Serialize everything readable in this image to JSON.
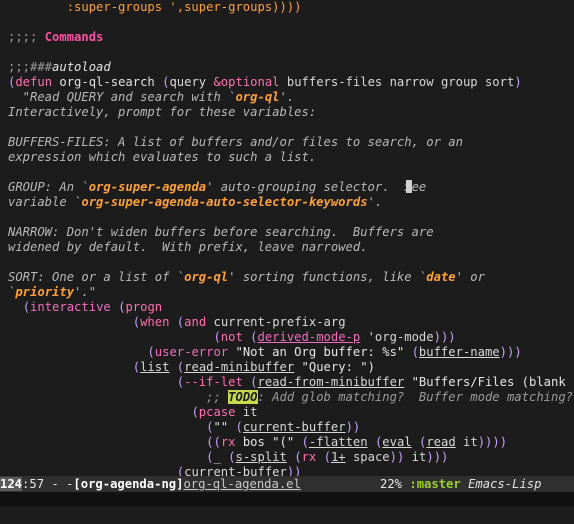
{
  "colors": {
    "background": "#1c1c1c",
    "default": "#d8d8d8",
    "comment": "#9a9a9a",
    "heading": "#ff4fa3",
    "keyword": "#ff6fb0",
    "function_name": "#e0e0e0",
    "docstring": "#b8b8b8",
    "constant": "#ff9f3a",
    "builtin": "#f06fbf",
    "string": "#e6e6e6",
    "paren": "#c7a0ff",
    "todo": "#c7d94a",
    "modeline_bg": "#303030",
    "branch": "#9acd32"
  },
  "editor": {
    "lines": [
      {
        "segments": [
          {
            "t": "        :super-groups ',super-groups))))",
            "c": "#ff9f3a"
          }
        ]
      },
      {
        "segments": []
      },
      {
        "segments": [
          {
            "t": ";;;; ",
            "c": "#9a9a9a"
          },
          {
            "t": "Commands",
            "c": "#ff4fa3",
            "b": true
          }
        ]
      },
      {
        "segments": []
      },
      {
        "segments": [
          {
            "t": ";;;###",
            "c": "#9a9a9a"
          },
          {
            "t": "autoload",
            "c": "#e0e0e0",
            "i": true
          }
        ]
      },
      {
        "segments": [
          {
            "t": "(",
            "c": "#c7a0ff"
          },
          {
            "t": "defun",
            "c": "#ff6fb0"
          },
          {
            "t": " org-ql-search ",
            "c": "#e0e0e0"
          },
          {
            "t": "(",
            "c": "#c7a0ff"
          },
          {
            "t": "query ",
            "c": "#d8d8d8"
          },
          {
            "t": "&optional",
            "c": "#ff6fb0"
          },
          {
            "t": " buffers-files narrow group sort",
            "c": "#d8d8d8"
          },
          {
            "t": ")",
            "c": "#c7a0ff"
          }
        ]
      },
      {
        "segments": [
          {
            "t": "  \"Read QUERY and search with `",
            "c": "#b8b8b8",
            "i": true
          },
          {
            "t": "org-ql",
            "c": "#ff9f3a",
            "b": true,
            "i": true
          },
          {
            "t": "'.",
            "c": "#b8b8b8",
            "i": true
          }
        ]
      },
      {
        "segments": [
          {
            "t": "Interactively, prompt for these variables:",
            "c": "#b8b8b8",
            "i": true
          }
        ]
      },
      {
        "segments": []
      },
      {
        "segments": [
          {
            "t": "BUFFERS-FILES: A list of buffers and/or files to search, or an",
            "c": "#b8b8b8",
            "i": true
          }
        ]
      },
      {
        "segments": [
          {
            "t": "expression which evaluates to such a list.",
            "c": "#b8b8b8",
            "i": true
          }
        ]
      },
      {
        "segments": []
      },
      {
        "segments": [
          {
            "t": "GROUP: An `",
            "c": "#b8b8b8",
            "i": true
          },
          {
            "t": "org-super-agenda",
            "c": "#ff9f3a",
            "b": true,
            "i": true
          },
          {
            "t": "' auto-grouping selector.  See",
            "c": "#b8b8b8",
            "i": true
          }
        ]
      },
      {
        "segments": [
          {
            "t": "variable `",
            "c": "#b8b8b8",
            "i": true
          },
          {
            "t": "org-super-agenda-auto-selector-keywords",
            "c": "#ff9f3a",
            "b": true,
            "i": true
          },
          {
            "t": "'.",
            "c": "#b8b8b8",
            "i": true
          }
        ]
      },
      {
        "segments": []
      },
      {
        "segments": [
          {
            "t": "NARROW: Don't widen buffers before searching.  Buffers are",
            "c": "#b8b8b8",
            "i": true
          }
        ]
      },
      {
        "segments": [
          {
            "t": "widened by default.  With prefix, leave narrowed.",
            "c": "#b8b8b8",
            "i": true
          }
        ]
      },
      {
        "segments": []
      },
      {
        "segments": [
          {
            "t": "SORT: One or a list of `",
            "c": "#b8b8b8",
            "i": true
          },
          {
            "t": "org-ql",
            "c": "#ff9f3a",
            "b": true,
            "i": true
          },
          {
            "t": "' sorting functions, like `",
            "c": "#b8b8b8",
            "i": true
          },
          {
            "t": "date",
            "c": "#ff9f3a",
            "b": true,
            "i": true
          },
          {
            "t": "' or",
            "c": "#b8b8b8",
            "i": true
          }
        ]
      },
      {
        "segments": [
          {
            "t": "`",
            "c": "#b8b8b8",
            "i": true
          },
          {
            "t": "priority",
            "c": "#ff9f3a",
            "b": true,
            "i": true
          },
          {
            "t": "'.\"",
            "c": "#b8b8b8",
            "i": true
          }
        ]
      },
      {
        "segments": [
          {
            "t": "  ",
            "c": "#d8d8d8"
          },
          {
            "t": "(",
            "c": "#c7a0ff"
          },
          {
            "t": "interactive",
            "c": "#f06fbf"
          },
          {
            "t": " ",
            "c": "#d8d8d8"
          },
          {
            "t": "(",
            "c": "#c7a0ff"
          },
          {
            "t": "progn",
            "c": "#ff6fb0"
          }
        ]
      },
      {
        "segments": [
          {
            "t": "                 ",
            "c": "#d8d8d8"
          },
          {
            "t": "(",
            "c": "#c7a0ff"
          },
          {
            "t": "when",
            "c": "#ff6fb0"
          },
          {
            "t": " ",
            "c": "#d8d8d8"
          },
          {
            "t": "(",
            "c": "#c7a0ff"
          },
          {
            "t": "and",
            "c": "#ff6fb0"
          },
          {
            "t": " current-prefix-arg",
            "c": "#d8d8d8"
          }
        ]
      },
      {
        "segments": [
          {
            "t": "                            ",
            "c": "#d8d8d8"
          },
          {
            "t": "(",
            "c": "#c7a0ff"
          },
          {
            "t": "not",
            "c": "#ff6fb0"
          },
          {
            "t": " ",
            "c": "#d8d8d8"
          },
          {
            "t": "(",
            "c": "#c7a0ff"
          },
          {
            "t": "derived-mode-p",
            "c": "#f06fbf",
            "u": true
          },
          {
            "t": " 'org-mode",
            "c": "#d8d8d8"
          },
          {
            "t": ")))",
            "c": "#c7a0ff"
          }
        ]
      },
      {
        "segments": [
          {
            "t": "                   ",
            "c": "#d8d8d8"
          },
          {
            "t": "(",
            "c": "#c7a0ff"
          },
          {
            "t": "user-error",
            "c": "#f06fbf"
          },
          {
            "t": " \"Not an Org buffer: %s\" ",
            "c": "#e6e6e6"
          },
          {
            "t": "(",
            "c": "#c7a0ff"
          },
          {
            "t": "buffer-name",
            "c": "#d8d8d8",
            "u": true
          },
          {
            "t": ")))",
            "c": "#c7a0ff"
          }
        ]
      },
      {
        "segments": [
          {
            "t": "                 ",
            "c": "#d8d8d8"
          },
          {
            "t": "(",
            "c": "#c7a0ff"
          },
          {
            "t": "list",
            "c": "#d8d8d8",
            "u": true
          },
          {
            "t": " ",
            "c": "#d8d8d8"
          },
          {
            "t": "(",
            "c": "#c7a0ff"
          },
          {
            "t": "read-minibuffer",
            "c": "#d8d8d8",
            "u": true
          },
          {
            "t": " \"Query: \")",
            "c": "#e6e6e6"
          }
        ]
      },
      {
        "segments": [
          {
            "t": "                       ",
            "c": "#d8d8d8"
          },
          {
            "t": "(",
            "c": "#c7a0ff"
          },
          {
            "t": "--if-let",
            "c": "#ff6fb0"
          },
          {
            "t": " ",
            "c": "#d8d8d8"
          },
          {
            "t": "(",
            "c": "#c7a0ff"
          },
          {
            "t": "read-from-minibuffer",
            "c": "#d8d8d8",
            "u": true
          },
          {
            "t": " \"Buffers/Files (blank for",
            "c": "#e6e6e6"
          }
        ]
      },
      {
        "segments": [
          {
            "t": "                           ",
            "c": "#d8d8d8"
          },
          {
            "t": ";; ",
            "c": "#9a9a9a",
            "i": true
          },
          {
            "t": "TODO",
            "c": "#1c1c1c",
            "bg": "#c7d94a",
            "b": true,
            "i": true
          },
          {
            "t": ": Add glob matching?  Buffer mode matching?",
            "c": "#9a9a9a",
            "i": true
          }
        ]
      },
      {
        "segments": [
          {
            "t": "                         ",
            "c": "#d8d8d8"
          },
          {
            "t": "(",
            "c": "#c7a0ff"
          },
          {
            "t": "pcase",
            "c": "#ff6fb0"
          },
          {
            "t": " it",
            "c": "#d8d8d8"
          }
        ]
      },
      {
        "segments": [
          {
            "t": "                           ",
            "c": "#d8d8d8"
          },
          {
            "t": "(",
            "c": "#c7a0ff"
          },
          {
            "t": "\"\" ",
            "c": "#e6e6e6"
          },
          {
            "t": "(",
            "c": "#c7a0ff"
          },
          {
            "t": "current-buffer",
            "c": "#d8d8d8",
            "u": true
          },
          {
            "t": "))",
            "c": "#c7a0ff"
          }
        ]
      },
      {
        "segments": [
          {
            "t": "                           ",
            "c": "#d8d8d8"
          },
          {
            "t": "((",
            "c": "#c7a0ff"
          },
          {
            "t": "rx",
            "c": "#ff6fb0"
          },
          {
            "t": " bos \"(\" ",
            "c": "#e6e6e6"
          },
          {
            "t": "(",
            "c": "#c7a0ff"
          },
          {
            "t": "-flatten",
            "c": "#d8d8d8",
            "u": true
          },
          {
            "t": " ",
            "c": "#d8d8d8"
          },
          {
            "t": "(",
            "c": "#c7a0ff"
          },
          {
            "t": "eval",
            "c": "#d8d8d8",
            "u": true
          },
          {
            "t": " ",
            "c": "#d8d8d8"
          },
          {
            "t": "(",
            "c": "#c7a0ff"
          },
          {
            "t": "read",
            "c": "#d8d8d8",
            "u": true
          },
          {
            "t": " it",
            "c": "#d8d8d8"
          },
          {
            "t": "))))",
            "c": "#c7a0ff"
          }
        ]
      },
      {
        "segments": [
          {
            "t": "                           ",
            "c": "#d8d8d8"
          },
          {
            "t": "(",
            "c": "#c7a0ff"
          },
          {
            "t": "_",
            "c": "#d8d8d8"
          },
          {
            "t": " ",
            "c": "#d8d8d8"
          },
          {
            "t": "(",
            "c": "#c7a0ff"
          },
          {
            "t": "s-split",
            "c": "#d8d8d8",
            "u": true
          },
          {
            "t": " ",
            "c": "#d8d8d8"
          },
          {
            "t": "(",
            "c": "#c7a0ff"
          },
          {
            "t": "rx",
            "c": "#ff6fb0"
          },
          {
            "t": " ",
            "c": "#d8d8d8"
          },
          {
            "t": "(",
            "c": "#c7a0ff"
          },
          {
            "t": "1+",
            "c": "#d8d8d8",
            "u": true
          },
          {
            "t": " space",
            "c": "#d8d8d8"
          },
          {
            "t": ")) ",
            "c": "#c7a0ff"
          },
          {
            "t": "it",
            "c": "#d8d8d8"
          },
          {
            "t": ")))",
            "c": "#c7a0ff"
          }
        ]
      },
      {
        "segments": [
          {
            "t": "                       ",
            "c": "#d8d8d8"
          },
          {
            "t": "(",
            "c": "#c7a0ff"
          },
          {
            "t": "current-buffer",
            "c": "#d8d8d8",
            "u": true
          },
          {
            "t": "))",
            "c": "#c7a0ff"
          }
        ]
      }
    ]
  },
  "modeline": {
    "line_number": "124",
    "column": ":57 - -",
    "buffer_name": "[org-agenda-ng]",
    "file_name": "org-ql-agenda.el",
    "percent": "22%",
    "branch": ":master",
    "major_mode": "Emacs-Lisp"
  }
}
